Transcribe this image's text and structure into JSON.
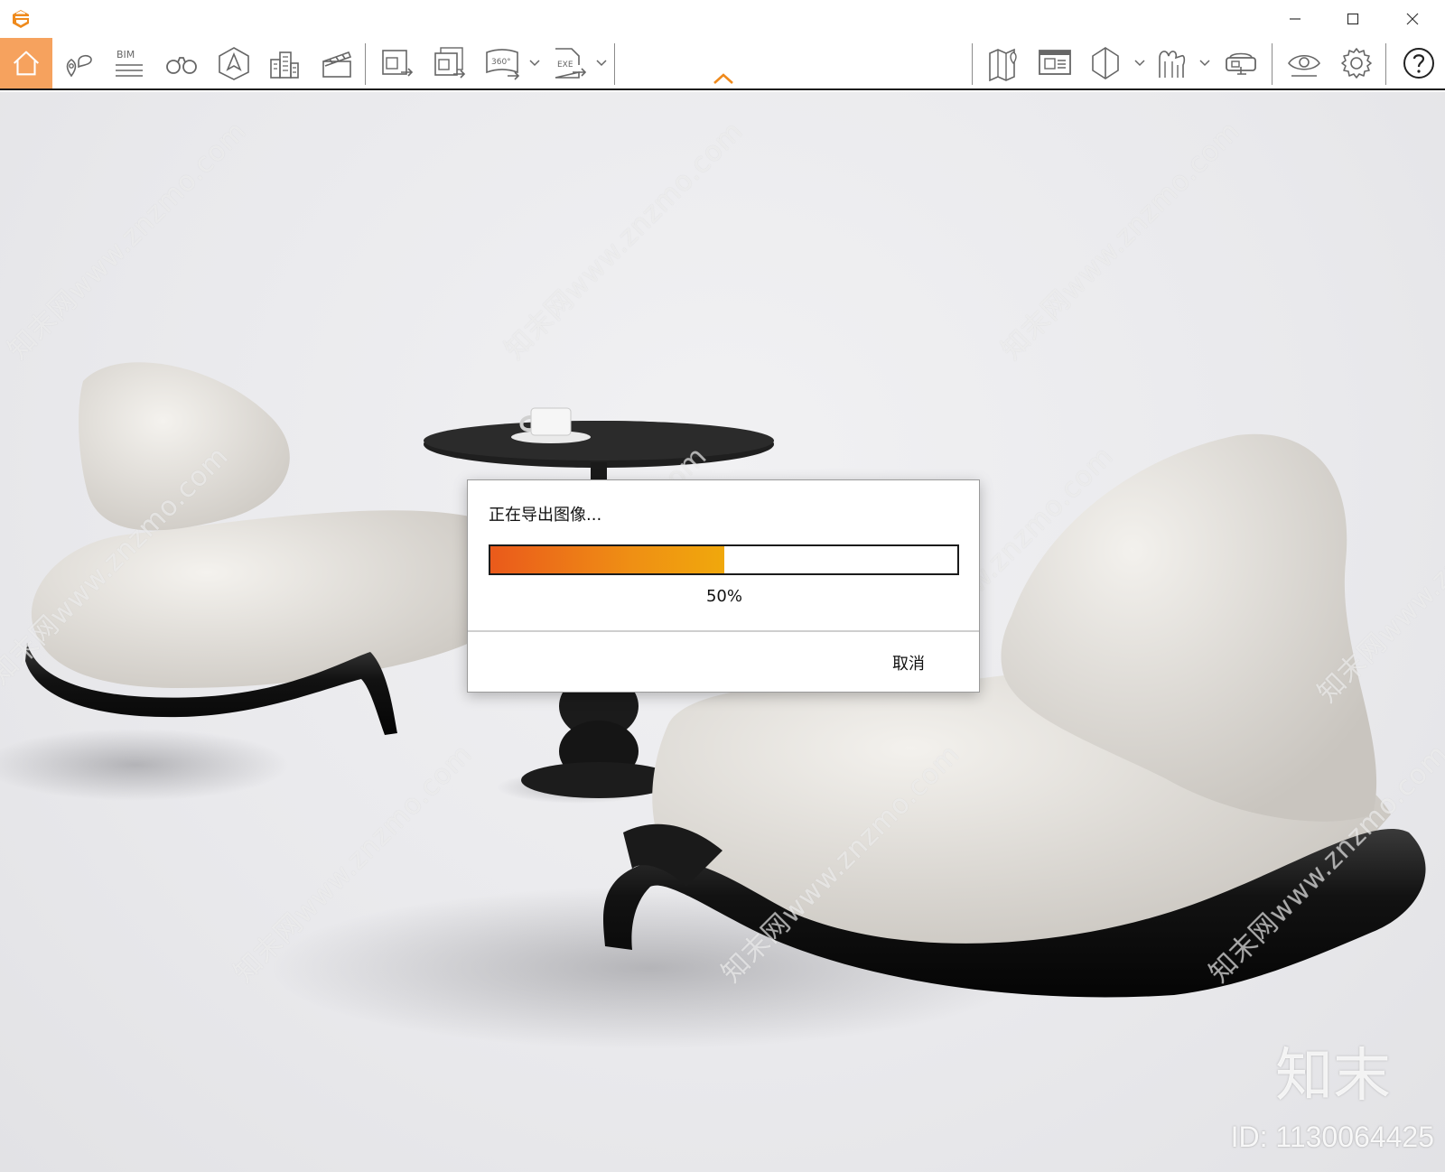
{
  "window": {
    "logo_icon": "app-logo-e",
    "controls": [
      "minimize-icon",
      "maximize-icon",
      "close-icon"
    ]
  },
  "toolbar": {
    "bim_label": "BIM",
    "view360_label": "360°",
    "exe_label": "EXE",
    "left_tools": [
      "home-icon",
      "location-pin-icon",
      "bim-icon",
      "binoculars-icon",
      "navigation-cube-icon",
      "buildings-icon",
      "clapperboard-icon"
    ],
    "export_tools": [
      "export-image-icon",
      "export-batch-icon",
      "export-360-icon",
      "export-exe-icon"
    ],
    "right_tools": [
      "map-icon",
      "screen-icon",
      "section-box-icon",
      "arch-icon",
      "vr-headset-icon",
      "eye-icon",
      "gear-icon",
      "help-icon"
    ],
    "accent_color": "#f6a25e",
    "collapse_icon": "chevron-up-icon"
  },
  "dialog": {
    "message": "正在导出图像...",
    "progress_fraction": 0.5,
    "progress_text": "50%",
    "cancel_label": "取消",
    "fill_colors": [
      "#ea5a1b",
      "#f0a80c"
    ]
  },
  "watermark": {
    "text": "知末网www.znzmo.com",
    "brand": "知末",
    "id_text": "ID: 1130064425"
  }
}
